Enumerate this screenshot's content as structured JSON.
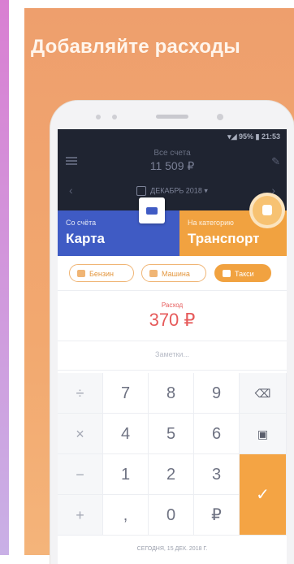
{
  "headline": "Добавляйте расходы",
  "status_bar": {
    "text": "▾◢ 95% ▮ 21:53"
  },
  "balance": {
    "label": "Все счета",
    "value": "11 509 ₽"
  },
  "period": {
    "label": "ДЕКАБРЬ 2018 ▾"
  },
  "from_account": {
    "caption": "Со счёта",
    "name": "Карта"
  },
  "to_category": {
    "caption": "На категорию",
    "name": "Транспорт"
  },
  "chips": [
    {
      "label": "Бензин"
    },
    {
      "label": "Машина"
    },
    {
      "label": "Такси"
    }
  ],
  "amount": {
    "label": "Расход",
    "value": "370 ₽"
  },
  "note": {
    "placeholder": "Заметки..."
  },
  "keypad": {
    "ops": [
      "÷",
      "×",
      "−",
      "+"
    ],
    "digits": [
      "7",
      "8",
      "9",
      "4",
      "5",
      "6",
      "1",
      "2",
      "3",
      ",",
      "0",
      "₽"
    ],
    "backspace": "⌫",
    "calendar": "▣",
    "confirm": "✓"
  },
  "footer": {
    "date_text": "СЕГОДНЯ, 15 ДЕК. 2018 Г."
  },
  "icons": [
    "menu-icon",
    "edit-icon",
    "calendar-icon",
    "wallet-icon",
    "bus-icon",
    "backspace-icon",
    "check-icon"
  ],
  "colors": {
    "accent": "#f1a240",
    "blue": "#3f5bc4",
    "expense": "#e65a5a",
    "header": "#1f2431"
  }
}
